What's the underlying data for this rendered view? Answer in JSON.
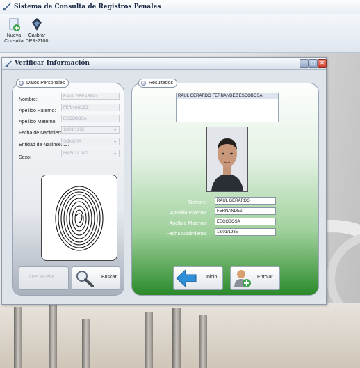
{
  "app": {
    "title": "Sistema de Consulta de Registros Penales"
  },
  "toolbar": {
    "buttons": [
      {
        "label": "Nueva Consulta",
        "icon": "new-query-icon"
      },
      {
        "label": "Calibrar DPR-2100",
        "icon": "calibrate-icon"
      }
    ]
  },
  "window": {
    "title": "Verificar Información",
    "controls": {
      "minimize": "–",
      "maximize": "□",
      "close": "✕"
    }
  },
  "datos": {
    "tab_label": "Datos Personales",
    "fields": [
      {
        "label": "Nombre:",
        "value": "RAUL GERARDO",
        "type": "text"
      },
      {
        "label": "Apellido Paterno:",
        "value": "FERNANDEZ",
        "type": "text"
      },
      {
        "label": "Apellido Materno:",
        "value": "ESCOBOSA",
        "type": "text"
      },
      {
        "label": "Fecha de Nacimiento:",
        "value": "18/01/1985",
        "type": "select"
      },
      {
        "label": "Entidad de Nacimiento:",
        "value": "SONORA",
        "type": "select"
      },
      {
        "label": "Sexo:",
        "value": "MASCULINO",
        "type": "select"
      }
    ],
    "leer_huella_label": "Leer Huella",
    "buscar_label": "Buscar"
  },
  "resultados": {
    "tab_label": "Resultados",
    "list_header": "RAUL GERARDO FERNANDEZ ESCOBOSA",
    "fields": [
      {
        "label": "Nombre:",
        "value": "RAUL GERARDO"
      },
      {
        "label": "Apellido Paterno:",
        "value": "FERNANDEZ"
      },
      {
        "label": "Apellido Materno:",
        "value": "ESCOBOSA"
      },
      {
        "label": "Fecha Nacimiento:",
        "value": "18/01/1985"
      }
    ],
    "inicio_label": "Inicio",
    "enrolar_label": "Enrolar"
  },
  "colors": {
    "accent_green": "#2b8a2b",
    "arrow_blue": "#2f8ed8"
  }
}
